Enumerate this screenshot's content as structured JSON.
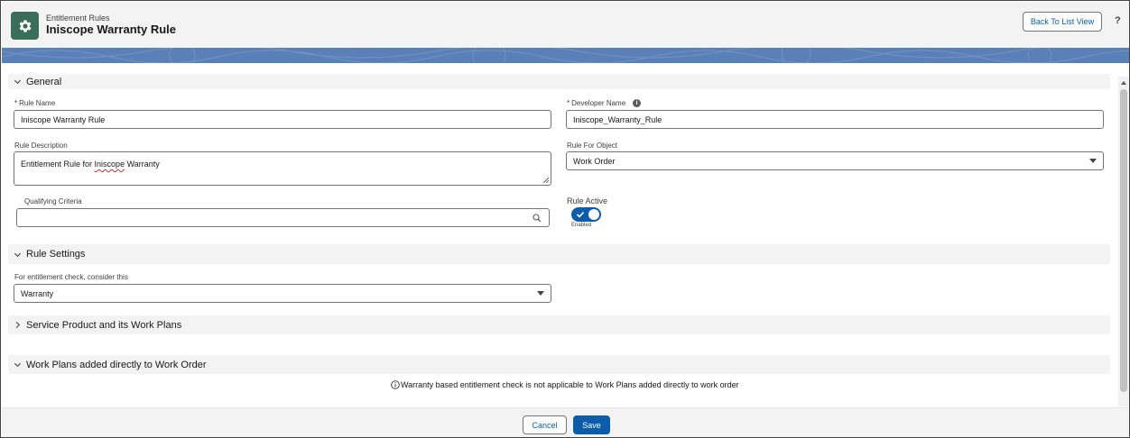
{
  "header": {
    "subtitle": "Entitlement Rules",
    "title": "Iniscope Warranty Rule",
    "back_button": "Back To List View",
    "help": "?",
    "icon": "gear-icon"
  },
  "sections": {
    "general": "General",
    "rule_settings": "Rule Settings",
    "service_product": "Service Product and its Work Plans",
    "work_plans": "Work Plans added directly to Work Order"
  },
  "fields": {
    "rule_name": {
      "label": "Rule Name",
      "value": "Iniscope Warranty Rule",
      "required": "*"
    },
    "developer_name": {
      "label": "Developer Name",
      "value": "Iniscope_Warranty_Rule",
      "required": "*"
    },
    "rule_description": {
      "label": "Rule Description",
      "value_prefix": "Entitlement Rule for ",
      "value_misspelled": "Iniscope",
      "value_suffix": " Warranty"
    },
    "rule_for_object": {
      "label": "Rule For Object",
      "value": "Work Order"
    },
    "qualifying_criteria": {
      "label": "Qualifying Criteria",
      "value": ""
    },
    "rule_active": {
      "label": "Rule Active",
      "state_text": "Enabled",
      "on": true
    },
    "entitlement_check": {
      "label": "For entitlement check, consider this",
      "value": "Warranty"
    }
  },
  "info_message": "Warranty based entitlement check is not applicable to Work Plans added directly to work order",
  "footer": {
    "cancel": "Cancel",
    "save": "Save"
  },
  "colors": {
    "brand": "#0b5cab",
    "app_icon": "#3b6e5a",
    "banner": "#5a80b8",
    "required": "#ba0517"
  }
}
